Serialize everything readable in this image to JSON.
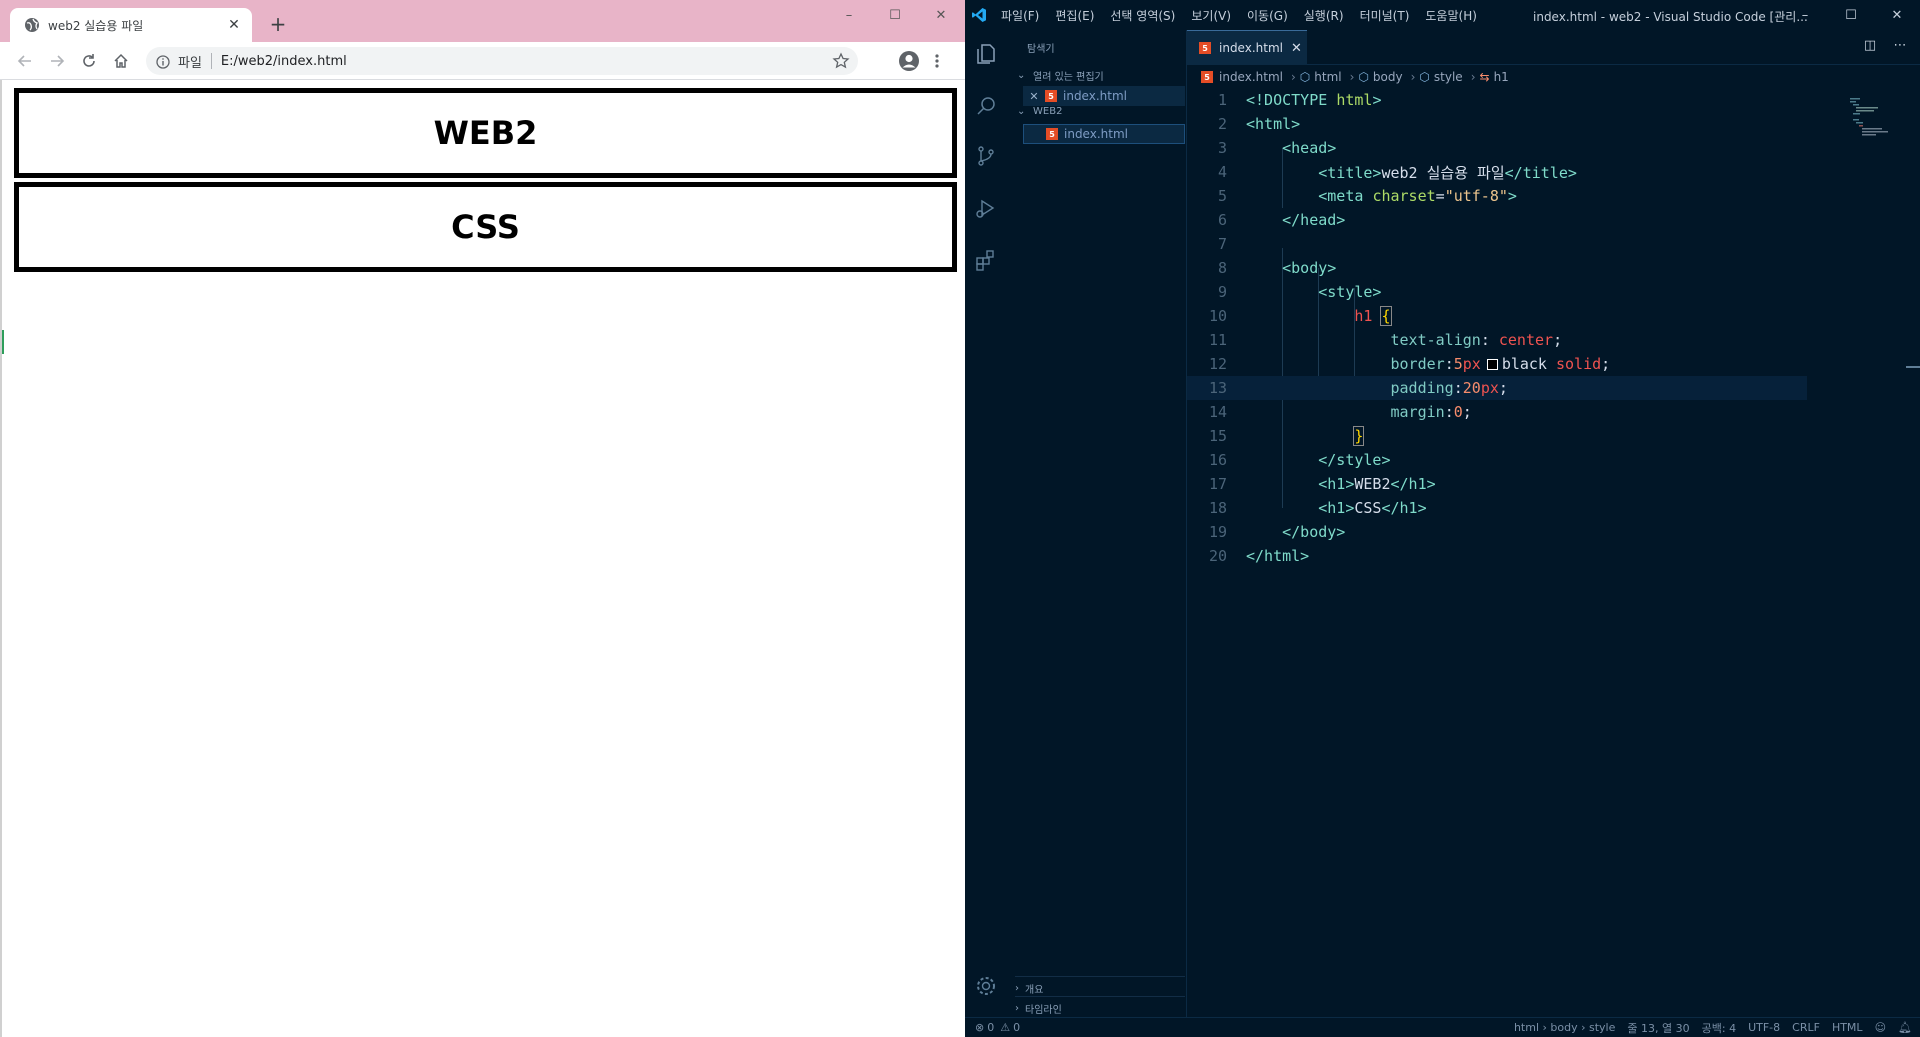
{
  "browser": {
    "tab": {
      "title": "web2 실습용 파일",
      "close": "✕"
    },
    "new_tab": "+",
    "window_controls": [
      "–",
      "☐",
      "✕"
    ],
    "omnibox": {
      "scheme": "파일",
      "url": "E:/web2/index.html"
    },
    "page": {
      "headings": [
        "WEB2",
        "CSS"
      ]
    }
  },
  "vscode": {
    "menu": [
      "파일(F)",
      "편집(E)",
      "선택 영역(S)",
      "보기(V)",
      "이동(G)",
      "실행(R)",
      "터미널(T)",
      "도움말(H)"
    ],
    "window_title": "index.html - web2 - Visual Studio Code [관리...",
    "window_controls": [
      "–",
      "☐",
      "✕"
    ],
    "explorer": {
      "title": "탐색기",
      "open_editors_label": "열려 있는 편집기",
      "open_editor_file": "index.html",
      "folder_label": "WEB2",
      "folder_file": "index.html",
      "outline_label": "개요",
      "timeline_label": "타임라인"
    },
    "editor_tab": {
      "label": "index.html",
      "close": "✕"
    },
    "breadcrumbs": [
      "index.html",
      "html",
      "body",
      "style",
      "h1"
    ],
    "line_numbers": [
      "1",
      "2",
      "3",
      "4",
      "5",
      "6",
      "7",
      "8",
      "9",
      "10",
      "11",
      "12",
      "13",
      "14",
      "15",
      "16",
      "17",
      "18",
      "19",
      "20"
    ],
    "code": {
      "l1_doctype": "<!DOCTYPE",
      "l1_html": "html",
      "l1_close": ">",
      "l2": "<html>",
      "l3": "<head>",
      "l4_open": "<title>",
      "l4_text": "web2 실습용 파일",
      "l4_close": "</title>",
      "l5_open": "<meta",
      "l5_attr": "charset",
      "l5_eq": "=",
      "l5_val": "\"utf-8\"",
      "l5_close": ">",
      "l6": "</head>",
      "l8": "<body>",
      "l9": "<style>",
      "l10_sel": "h1",
      "l10_brace": "{",
      "l11_prop": "text-align",
      "l11_colon": ":",
      "l11_val": "center",
      "l11_semi": ";",
      "l12_prop": "border",
      "l12_colon": ":",
      "l12_num": "5",
      "l12_unit": "px",
      "l12_color": "black",
      "l12_style": "solid",
      "l12_semi": ";",
      "l13_prop": "padding",
      "l13_colon": ":",
      "l13_num": "20",
      "l13_unit": "px",
      "l13_semi": ";",
      "l14_prop": "margin",
      "l14_colon": ":",
      "l14_num": "0",
      "l14_semi": ";",
      "l15": "}",
      "l16": "</style>",
      "l17_open": "<h1>",
      "l17_text": "WEB2",
      "l17_close": "</h1>",
      "l18_open": "<h1>",
      "l18_text": "CSS",
      "l18_close": "</h1>",
      "l19": "</body>",
      "l20": "</html>"
    },
    "status": {
      "errors": "0",
      "warnings": "0",
      "path": "html › body › style",
      "position": "줄 13, 열 30",
      "spaces": "공백: 4",
      "encoding": "UTF-8",
      "eol": "CRLF",
      "language": "HTML"
    }
  },
  "colors": {
    "chrome_tabbar": "#e8b4c8",
    "vscode_bg": "#011627",
    "html_icon": "#e44d26"
  }
}
